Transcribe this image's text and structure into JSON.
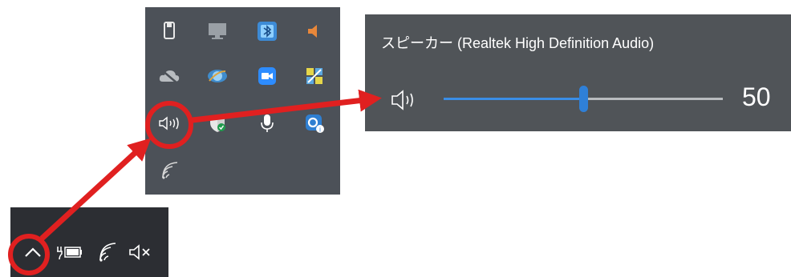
{
  "volume_flyout": {
    "device_name": "スピーカー (Realtek High Definition Audio)",
    "volume_value": "50",
    "volume_level": 0.5,
    "speaker_icon": "speaker-icon"
  },
  "tray_popup": {
    "icons": [
      "usb-drive-icon",
      "monitor-icon",
      "bluetooth-icon",
      "orange-speaker-icon",
      "cloud-offline-icon",
      "eye-icon",
      "zoom-camera-icon",
      "colorful-app-icon",
      "volume-icon",
      "shield-icon",
      "microphone-icon",
      "app-badge-icon",
      "wifi-icon"
    ]
  },
  "taskbar": {
    "icons": [
      "chevron-up-icon",
      "battery-charging-icon",
      "wifi-icon",
      "muted-speaker-icon"
    ]
  },
  "colors": {
    "annotation_red": "#e02020",
    "slider_accent": "#2f80d8",
    "tray_background": "#4c5158",
    "flyout_background": "#505458",
    "taskbar_background": "#2c2e33"
  }
}
